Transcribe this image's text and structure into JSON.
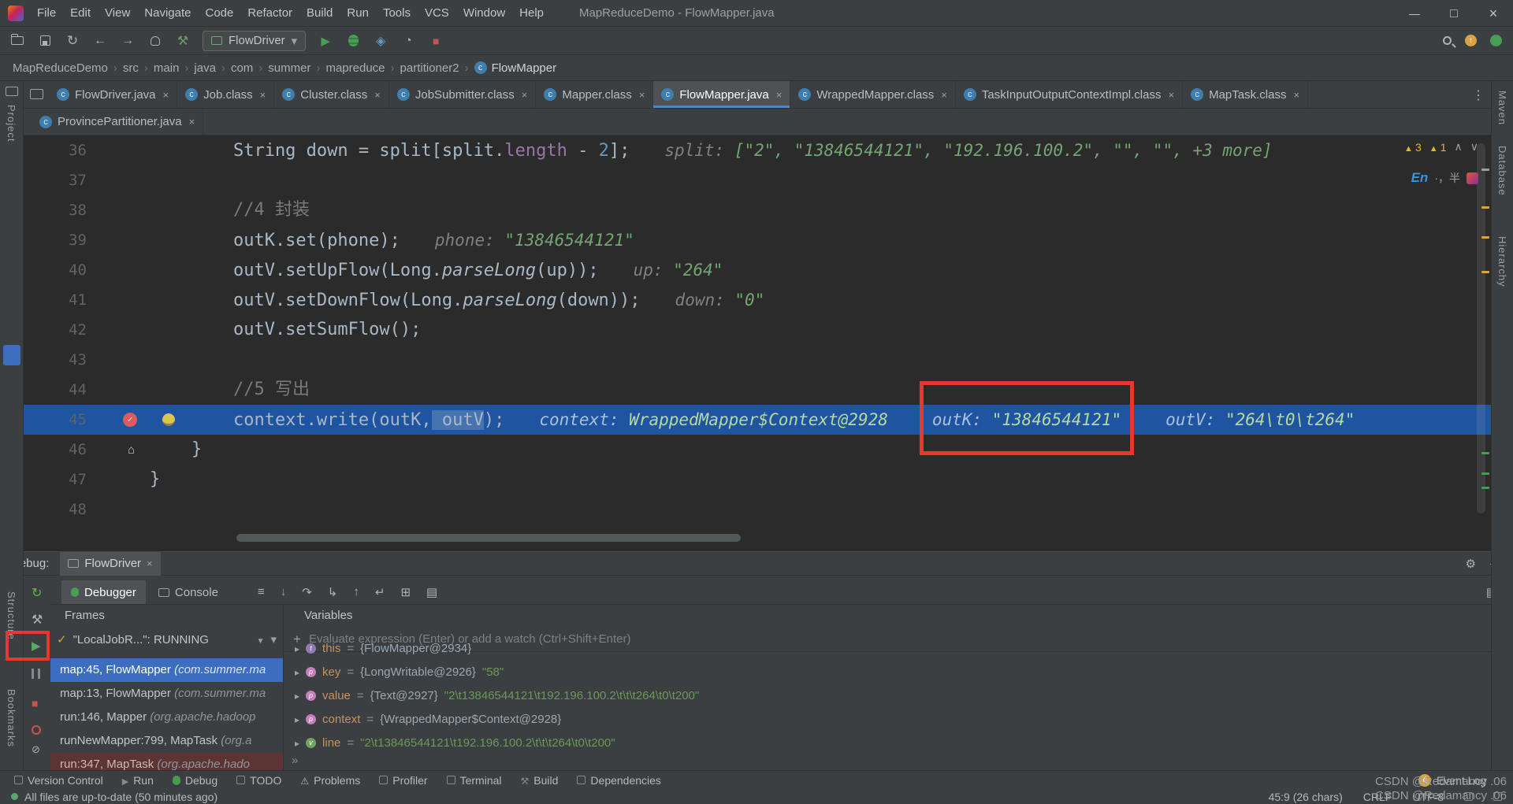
{
  "titlebar": {
    "menus": [
      "File",
      "Edit",
      "View",
      "Navigate",
      "Code",
      "Refactor",
      "Build",
      "Run",
      "Tools",
      "VCS",
      "Window",
      "Help"
    ],
    "title": "MapReduceDemo - FlowMapper.java"
  },
  "toolbar": {
    "run_config": "FlowDriver"
  },
  "breadcrumbs": [
    "MapReduceDemo",
    "src",
    "main",
    "java",
    "com",
    "summer",
    "mapreduce",
    "partitioner2",
    "FlowMapper"
  ],
  "tabs": {
    "row1": [
      "FlowDriver.java",
      "Job.class",
      "Cluster.class",
      "JobSubmitter.class",
      "Mapper.class",
      "FlowMapper.java",
      "WrappedMapper.class",
      "TaskInputOutputContextImpl.class",
      "MapTask.class"
    ],
    "row2": [
      "ProvincePartitioner.java"
    ]
  },
  "stripes": {
    "left": [
      "Project",
      "Structure",
      "Bookmarks"
    ],
    "right": [
      "Maven",
      "Database",
      "Hierarchy"
    ]
  },
  "editor": {
    "lines": {
      "l36": {
        "num": "36",
        "c1": "        String down = split[split.",
        "c2": "length",
        "c3": " - ",
        "c4": "2",
        "c5": "];",
        "hl": "split: ",
        "hv": "[\"2\", \"13846544121\", \"192.196.100.2\", \"\", \"\", +3 more]"
      },
      "l37": {
        "num": "37"
      },
      "l38": {
        "num": "38",
        "c1": "        //4 封装"
      },
      "l39": {
        "num": "39",
        "c1": "        outK.set(phone);",
        "hl": "phone: ",
        "hv": "\"13846544121\""
      },
      "l40": {
        "num": "40",
        "c1": "        outV.setUpFlow(Long.",
        "c2": "parseLong",
        "c3": "(up));",
        "hl": "up: ",
        "hv": "\"264\""
      },
      "l41": {
        "num": "41",
        "c1": "        outV.setDownFlow(Long.",
        "c2": "parseLong",
        "c3": "(down));",
        "hl": "down: ",
        "hv": "\"0\""
      },
      "l42": {
        "num": "42",
        "c1": "        outV.setSumFlow();"
      },
      "l43": {
        "num": "43"
      },
      "l44": {
        "num": "44",
        "c1": "        //5 写出"
      },
      "l45": {
        "num": "45",
        "c1": "        context.write(outK,",
        "c2": " outV",
        "c3": ");",
        "h1l": "context: ",
        "h1v": "WrappedMapper$Context@2928",
        "h2l": "outK: ",
        "h2v": "\"13846544121\"",
        "h3l": "outV: ",
        "h3v": "\"264\\t0\\t264\""
      },
      "l46": {
        "num": "46",
        "c1": "    }"
      },
      "l47": {
        "num": "47",
        "c1": "}"
      },
      "l48": {
        "num": "48"
      }
    },
    "inspections": {
      "warnings": "3",
      "weak_warnings": "1"
    },
    "ime": {
      "lang": "En",
      "mode": "·，半"
    }
  },
  "debug": {
    "label": "Debug:",
    "session_tab": "FlowDriver",
    "view_tabs": [
      "Debugger",
      "Console"
    ],
    "frames": {
      "header": "Frames",
      "thread": "\"LocalJobR...\": RUNNING",
      "items": [
        {
          "m": "map:45, FlowMapper ",
          "p": "(com.summer.ma"
        },
        {
          "m": "map:13, FlowMapper ",
          "p": "(com.summer.ma"
        },
        {
          "m": "run:146, Mapper ",
          "p": "(org.apache.hadoop"
        },
        {
          "m": "runNewMapper:799, MapTask ",
          "p": "(org.a"
        },
        {
          "m": "run:347, MapTask ",
          "p": "(org.apache.hado"
        }
      ]
    },
    "variables": {
      "header": "Variables",
      "evaluate_placeholder": "Evaluate expression (Enter) or add a watch (Ctrl+Shift+Enter)",
      "items": [
        {
          "name": "this",
          "eq": " = ",
          "ref": "{FlowMapper@2934}",
          "str": ""
        },
        {
          "name": "key",
          "eq": " = ",
          "ref": "{LongWritable@2926} ",
          "str": "\"58\""
        },
        {
          "name": "value",
          "eq": " = ",
          "ref": "{Text@2927} ",
          "str": "\"2\\t13846544121\\t192.196.100.2\\t\\t\\t264\\t0\\t200\""
        },
        {
          "name": "context",
          "eq": " = ",
          "ref": "{WrappedMapper$Context@2928}",
          "str": ""
        },
        {
          "name": "line",
          "eq": " = ",
          "ref": "",
          "str": "\"2\\t13846544121\\t192.196.100.2\\t\\t\\t264\\t0\\t200\""
        }
      ]
    }
  },
  "bottom_bar": {
    "items": [
      "Version Control",
      "Run",
      "Debug",
      "TODO",
      "Problems",
      "Profiler",
      "Terminal",
      "Build",
      "Dependencies"
    ],
    "event_log_badge": "4",
    "event_log": "Event Log"
  },
  "status_bar": {
    "message": "All files are up-to-date (50 minutes ago)",
    "position": "45:9 (26 chars)",
    "line_ending": "CRLF",
    "encoding": "UTF-8"
  },
  "watermark": "CSDN @Redamancy .06"
}
